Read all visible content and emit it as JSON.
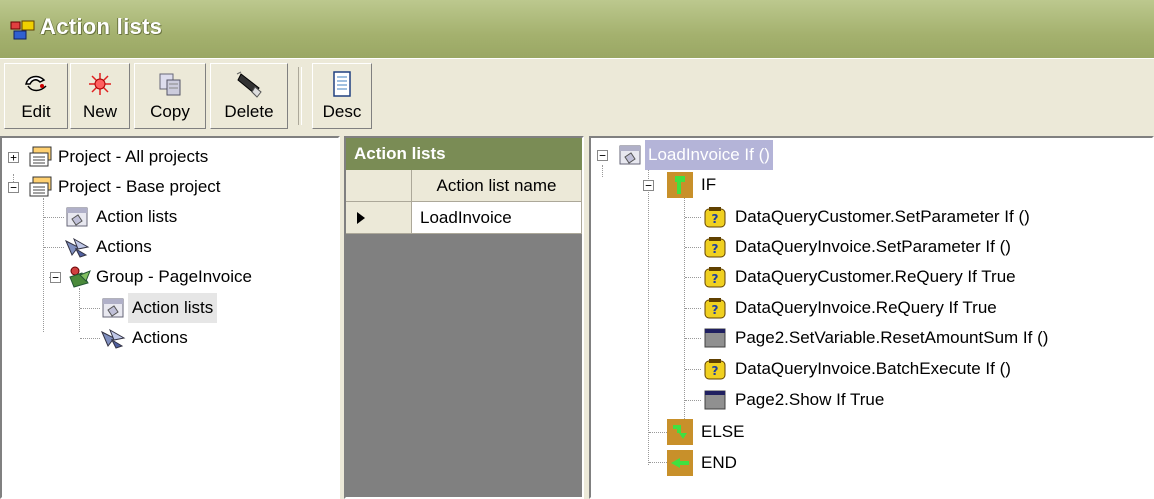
{
  "window": {
    "title": "Action lists"
  },
  "toolbar": {
    "edit": "Edit",
    "new": "New",
    "copy": "Copy",
    "delete": "Delete",
    "desc": "Desc"
  },
  "project_tree": {
    "all_projects": "Project - All projects",
    "base_project": "Project - Base project",
    "action_lists": "Action lists",
    "actions": "Actions",
    "group": "Group - PageInvoice",
    "group_action_lists": "Action lists",
    "group_actions": "Actions"
  },
  "action_lists_grid": {
    "header": "Action lists",
    "column": "Action list name",
    "rows": [
      "LoadInvoice"
    ]
  },
  "action_tree": {
    "root": "LoadInvoice If ()",
    "if": "IF",
    "items": [
      "DataQueryCustomer.SetParameter If ()",
      "DataQueryInvoice.SetParameter If ()",
      "DataQueryCustomer.ReQuery If True",
      "DataQueryInvoice.ReQuery If True",
      "Page2.SetVariable.ResetAmountSum If ()",
      "DataQueryInvoice.BatchExecute If ()",
      "Page2.Show If True"
    ],
    "else": "ELSE",
    "end": "END"
  }
}
